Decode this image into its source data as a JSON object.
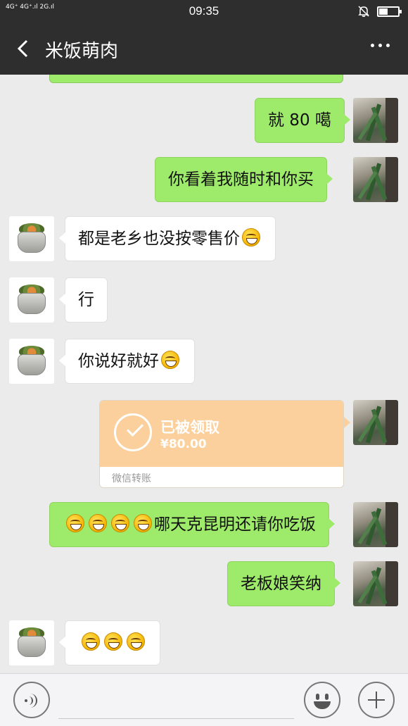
{
  "status_bar": {
    "signal_text": "4G⁺ 4G⁺.ıl 2G.ıl",
    "time": "09:35",
    "icons": [
      "mute-bell-icon",
      "battery-icon"
    ],
    "battery_level": 0.45
  },
  "header": {
    "title": "米饭萌肉",
    "back_icon": "chevron-left-icon",
    "more_icon": "more-dots-icon"
  },
  "colors": {
    "header_bg": "#2e2e2e",
    "chat_bg": "#ebebeb",
    "my_bubble": "#9eea6a",
    "their_bubble": "#ffffff",
    "transfer_bg": "#fbd09c"
  },
  "messages": [
    {
      "sender": "me",
      "text": "就 80 噶"
    },
    {
      "sender": "me",
      "text": "你看着我随时和你买"
    },
    {
      "sender": "them",
      "text": "都是老乡也没按零售价",
      "emoji_after": 1
    },
    {
      "sender": "them",
      "text": "行"
    },
    {
      "sender": "them",
      "text": "你说好就好",
      "emoji_after": 1
    },
    {
      "sender": "me",
      "type": "transfer",
      "status": "已被领取",
      "amount": "¥80.00",
      "label": "微信转账"
    },
    {
      "sender": "me",
      "text": "哪天克昆明还请你吃饭",
      "emoji_before": 4
    },
    {
      "sender": "me",
      "text": "老板娘笑纳"
    },
    {
      "sender": "them",
      "text": "",
      "emoji_only": 3
    }
  ],
  "input_bar": {
    "voice_icon": "voice-icon",
    "emoji_icon": "smiley-icon",
    "plus_icon": "plus-icon",
    "input_value": ""
  }
}
